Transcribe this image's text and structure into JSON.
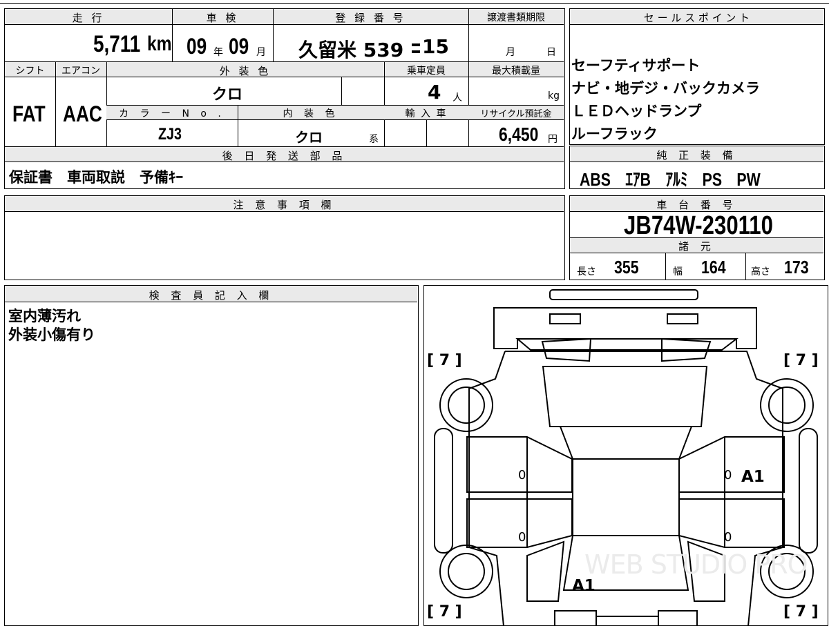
{
  "headers": {
    "mileage": "走 行",
    "inspection": "車 検",
    "registration": "登 録 番 号",
    "transfer_deadline": "譲渡書類期限",
    "sales_points": "セ ー ル ス ポ イ ン ト",
    "shift": "シフト",
    "aircon": "エアコン",
    "exterior_color": "外 装 色",
    "capacity": "乗車定員",
    "max_load": "最大積載量",
    "color_no": "カ ラ ー N o .",
    "interior_color": "内 装 色",
    "import": "輸 入 車",
    "recycle": "リサイクル預託金",
    "later_parts": "後 日 発 送 部 品",
    "genuine_equipment": "純 正 装 備",
    "notes": "注 意 事 項 欄",
    "chassis_number": "車 台 番 号",
    "specs": "諸 元",
    "inspector": "検 査 員 記 入 欄"
  },
  "vehicle": {
    "mileage_value": "5,711",
    "mileage_unit": "km",
    "inspection_year": "09",
    "year_unit": "年",
    "inspection_month": "09",
    "month_unit": "月",
    "registration_number": "久留米 539",
    "registration_suffix": "15",
    "transfer_month_unit": "月",
    "transfer_day_unit": "日",
    "shift_value": "FAT",
    "aircon_value": "AAC",
    "exterior_color_value": "クロ",
    "capacity_value": "4",
    "capacity_unit": "人",
    "max_load_unit": "kg",
    "color_no_value": "ZJ3",
    "interior_color_value": "クロ",
    "interior_color_suffix": "系",
    "recycle_value": "6,450",
    "recycle_unit": "円"
  },
  "sales_points": [
    "セーフティサポート",
    "ナビ・地デジ・バックカメラ",
    "ＬＥＤヘッドランプ",
    "ルーフラック"
  ],
  "later_parts_value": "保証書　車両取説　予備ｷｰ",
  "genuine_equipment_value": "ABS　ｴｱB　ｱﾙﾐ　PS　PW",
  "chassis_number_value": "JB74W-230110",
  "specs": {
    "length_label": "長さ",
    "length_value": "355",
    "width_label": "幅",
    "width_value": "164",
    "height_label": "高さ",
    "height_value": "173"
  },
  "inspector_notes": [
    "室内薄汚れ",
    "外装小傷有り"
  ],
  "diagram": {
    "tire_front_left": "[ 7 ]",
    "tire_front_right": "[ 7 ]",
    "tire_rear_left": "[ 7 ]",
    "tire_rear_right": "[ 7 ]",
    "door_fl": "0",
    "door_fr": "0",
    "door_rl": "0",
    "door_rr": "0",
    "mark_right_front": "A1",
    "mark_rear": "A1",
    "watermark": "WEB STUDIO PRO"
  }
}
